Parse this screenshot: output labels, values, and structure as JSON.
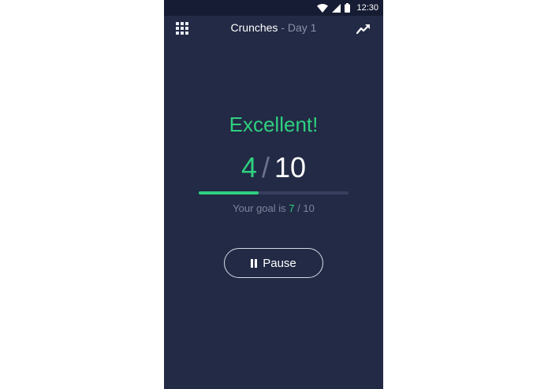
{
  "status_bar": {
    "time": "12:30",
    "icons": [
      "wifi-icon",
      "cellular-signal-icon",
      "battery-icon"
    ]
  },
  "app_bar": {
    "menu_icon": "apps-grid-icon",
    "title": "Crunches",
    "separator": "-",
    "subtitle": "Day 1",
    "action_icon": "trend-chart-icon"
  },
  "workout": {
    "feedback": "Excellent!",
    "current_reps": "4",
    "slash": "/",
    "total_reps": "10",
    "progress_fraction": 0.4,
    "goal_prefix": "Your goal is",
    "goal_target": "7",
    "goal_suffix": "/ 10"
  },
  "controls": {
    "pause_label": "Pause",
    "pause_icon": "pause-icon"
  },
  "colors": {
    "background": "#222a45",
    "status_bar": "#161c33",
    "accent": "#2fd07f",
    "muted_text": "#7d859c",
    "progress_track": "#36405e"
  }
}
